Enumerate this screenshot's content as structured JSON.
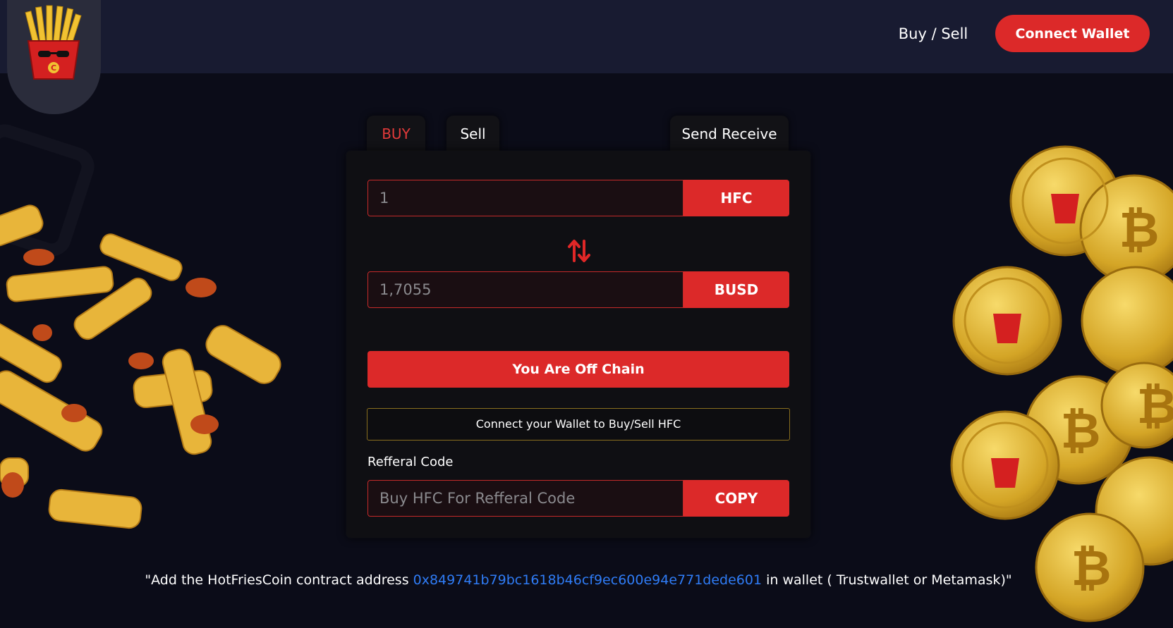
{
  "header": {
    "nav_link": "Buy / Sell",
    "connect_label": "Connect Wallet"
  },
  "logo": {
    "letter": "C"
  },
  "tabs": {
    "buy": "BUY",
    "sell": "Sell",
    "send_receive": "Send Receive"
  },
  "form": {
    "amount_from": "1",
    "token_from": "HFC",
    "amount_to": "1,7055",
    "token_to": "BUSD",
    "action_label": "You Are Off Chain",
    "notice": "Connect your Wallet to Buy/Sell HFC",
    "referral_label": "Refferal Code",
    "referral_placeholder": "Buy HFC For Refferal Code",
    "copy_label": "COPY"
  },
  "footer": {
    "prefix": "\"Add the HotFriesCoin contract address ",
    "address": "0x849741b79bc1618b46cf9ec600e94e771dede601",
    "suffix": " in wallet ( Trustwallet or Metamask)\""
  },
  "colors": {
    "accent": "#dc2929",
    "background": "#0b0c18",
    "header": "#181b31",
    "link": "#2f7cf6",
    "gold": "#d4a526"
  },
  "icons": [
    "fries-logo-icon",
    "swap-arrows-icon",
    "fries-decoration-icon",
    "coin-decoration-icon"
  ]
}
